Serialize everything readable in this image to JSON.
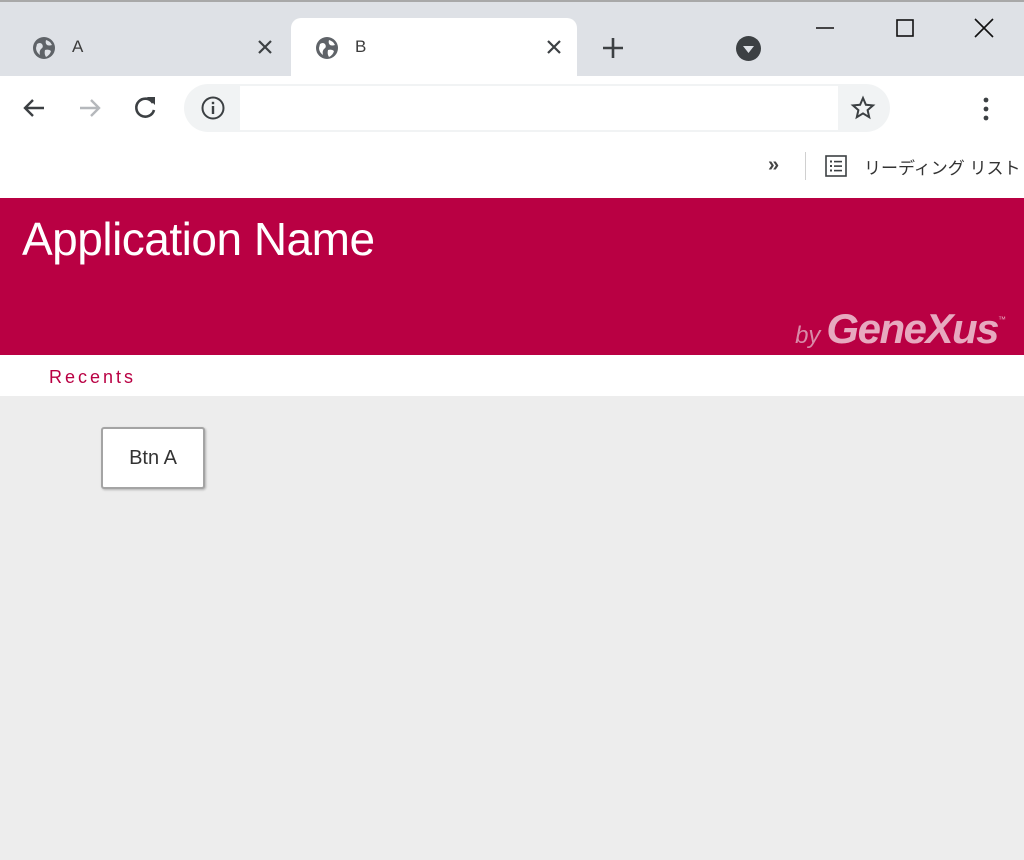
{
  "browser": {
    "tabs": [
      {
        "title": "A",
        "active": false
      },
      {
        "title": "B",
        "active": true
      }
    ],
    "address_bar": {
      "value": "",
      "placeholder": ""
    },
    "bookmarks": {
      "overflow": "»",
      "reading_list_label": "リーディング リスト"
    },
    "icons": {
      "tab_favicon": "globe-icon",
      "tab_close": "close-icon",
      "new_tab": "plus-icon",
      "tab_search": "tab-search-icon",
      "window_minimize": "minimize-icon",
      "window_maximize": "maximize-icon",
      "window_close": "window-close-icon",
      "back": "back-arrow-icon",
      "forward": "forward-arrow-icon",
      "reload": "reload-icon",
      "site_info": "info-icon",
      "bookmark_star": "star-icon",
      "menu": "more-vert-icon",
      "reading_list": "reading-list-icon"
    }
  },
  "app": {
    "title": "Application Name",
    "brand": {
      "by": "by",
      "name": "GeneXus",
      "tm": "™"
    },
    "recents_label": "Recents",
    "button_label": "Btn A",
    "colors": {
      "header_bg": "#b90043",
      "accent_text": "#b90043",
      "content_bg": "#ededed"
    }
  }
}
